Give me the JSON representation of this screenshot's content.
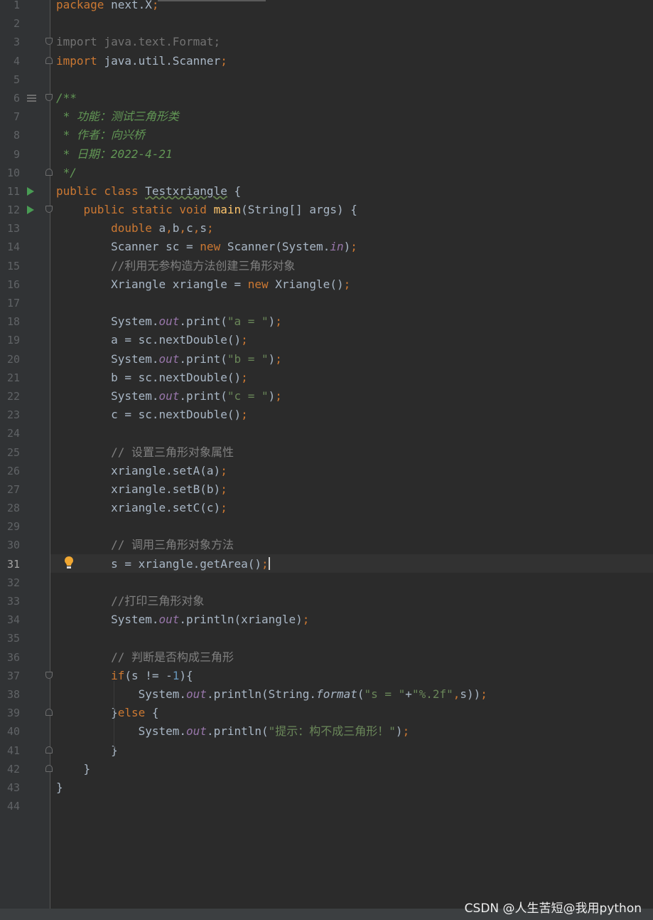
{
  "editor": {
    "file_language": "java",
    "current_line": 31,
    "lines": [
      {
        "n": "1",
        "tokens": [
          {
            "t": "package ",
            "c": "kw"
          },
          {
            "t": "next.X",
            "c": ""
          },
          {
            "t": ";",
            "c": "kw"
          }
        ]
      },
      {
        "n": "2",
        "tokens": []
      },
      {
        "n": "3",
        "fold": "open",
        "tokens": [
          {
            "t": "import java.text.Format;",
            "c": "dim"
          }
        ]
      },
      {
        "n": "4",
        "fold": "close",
        "tokens": [
          {
            "t": "import ",
            "c": "kw"
          },
          {
            "t": "java.util.Scanner",
            "c": ""
          },
          {
            "t": ";",
            "c": "kw"
          }
        ]
      },
      {
        "n": "5",
        "tokens": []
      },
      {
        "n": "6",
        "fold": "open",
        "marker": "menu",
        "tokens": [
          {
            "t": "/**",
            "c": "doc"
          }
        ]
      },
      {
        "n": "7",
        "tokens": [
          {
            "t": " * 功能：测试三角形类",
            "c": "doc"
          }
        ]
      },
      {
        "n": "8",
        "tokens": [
          {
            "t": " * 作者：向兴桥",
            "c": "doc"
          }
        ]
      },
      {
        "n": "9",
        "tokens": [
          {
            "t": " * 日期：2022-4-21",
            "c": "doc"
          }
        ]
      },
      {
        "n": "10",
        "fold": "close",
        "tokens": [
          {
            "t": " */",
            "c": "doc"
          }
        ]
      },
      {
        "n": "11",
        "marker": "run",
        "tokens": [
          {
            "t": "public class ",
            "c": "kw"
          },
          {
            "t": "Testxriangle",
            "c": "under"
          },
          {
            "t": " {",
            "c": ""
          }
        ]
      },
      {
        "n": "12",
        "marker": "run",
        "fold": "open",
        "tokens": [
          {
            "t": "    public static void ",
            "c": "kw"
          },
          {
            "t": "main",
            "c": "fn"
          },
          {
            "t": "(String[] args) {",
            "c": ""
          }
        ]
      },
      {
        "n": "13",
        "tokens": [
          {
            "t": "        double ",
            "c": "kw"
          },
          {
            "t": "a",
            "c": ""
          },
          {
            "t": ",",
            "c": "kw"
          },
          {
            "t": "b",
            "c": ""
          },
          {
            "t": ",",
            "c": "kw"
          },
          {
            "t": "c",
            "c": ""
          },
          {
            "t": ",",
            "c": "kw"
          },
          {
            "t": "s",
            "c": ""
          },
          {
            "t": ";",
            "c": "kw"
          }
        ]
      },
      {
        "n": "14",
        "tokens": [
          {
            "t": "        Scanner sc = ",
            "c": ""
          },
          {
            "t": "new ",
            "c": "kw"
          },
          {
            "t": "Scanner(System.",
            "c": ""
          },
          {
            "t": "in",
            "c": "sf"
          },
          {
            "t": ")",
            "c": ""
          },
          {
            "t": ";",
            "c": "kw"
          }
        ]
      },
      {
        "n": "15",
        "tokens": [
          {
            "t": "        //利用无参构造方法创建三角形对象",
            "c": "cmt"
          }
        ]
      },
      {
        "n": "16",
        "tokens": [
          {
            "t": "        Xriangle xriangle = ",
            "c": ""
          },
          {
            "t": "new ",
            "c": "kw"
          },
          {
            "t": "Xriangle()",
            "c": ""
          },
          {
            "t": ";",
            "c": "kw"
          }
        ]
      },
      {
        "n": "17",
        "tokens": []
      },
      {
        "n": "18",
        "tokens": [
          {
            "t": "        System.",
            "c": ""
          },
          {
            "t": "out",
            "c": "sf"
          },
          {
            "t": ".print(",
            "c": ""
          },
          {
            "t": "\"a = \"",
            "c": "str"
          },
          {
            "t": ")",
            "c": ""
          },
          {
            "t": ";",
            "c": "kw"
          }
        ]
      },
      {
        "n": "19",
        "tokens": [
          {
            "t": "        a = sc.nextDouble()",
            "c": ""
          },
          {
            "t": ";",
            "c": "kw"
          }
        ]
      },
      {
        "n": "20",
        "tokens": [
          {
            "t": "        System.",
            "c": ""
          },
          {
            "t": "out",
            "c": "sf"
          },
          {
            "t": ".print(",
            "c": ""
          },
          {
            "t": "\"b = \"",
            "c": "str"
          },
          {
            "t": ")",
            "c": ""
          },
          {
            "t": ";",
            "c": "kw"
          }
        ]
      },
      {
        "n": "21",
        "tokens": [
          {
            "t": "        b = sc.nextDouble()",
            "c": ""
          },
          {
            "t": ";",
            "c": "kw"
          }
        ]
      },
      {
        "n": "22",
        "tokens": [
          {
            "t": "        System.",
            "c": ""
          },
          {
            "t": "out",
            "c": "sf"
          },
          {
            "t": ".print(",
            "c": ""
          },
          {
            "t": "\"c = \"",
            "c": "str"
          },
          {
            "t": ")",
            "c": ""
          },
          {
            "t": ";",
            "c": "kw"
          }
        ]
      },
      {
        "n": "23",
        "tokens": [
          {
            "t": "        c = sc.nextDouble()",
            "c": ""
          },
          {
            "t": ";",
            "c": "kw"
          }
        ]
      },
      {
        "n": "24",
        "tokens": []
      },
      {
        "n": "25",
        "tokens": [
          {
            "t": "        // 设置三角形对象属性",
            "c": "cmt"
          }
        ]
      },
      {
        "n": "26",
        "tokens": [
          {
            "t": "        xriangle.setA(a)",
            "c": ""
          },
          {
            "t": ";",
            "c": "kw"
          }
        ]
      },
      {
        "n": "27",
        "tokens": [
          {
            "t": "        xriangle.setB(b)",
            "c": ""
          },
          {
            "t": ";",
            "c": "kw"
          }
        ]
      },
      {
        "n": "28",
        "tokens": [
          {
            "t": "        xriangle.setC(c)",
            "c": ""
          },
          {
            "t": ";",
            "c": "kw"
          }
        ]
      },
      {
        "n": "29",
        "tokens": []
      },
      {
        "n": "30",
        "tokens": [
          {
            "t": "        // 调用三角形对象方法",
            "c": "cmt"
          }
        ]
      },
      {
        "n": "31",
        "marker": "bulb",
        "caret": true,
        "tokens": [
          {
            "t": "        s = xriangle.getArea()",
            "c": ""
          },
          {
            "t": ";",
            "c": "kw"
          }
        ]
      },
      {
        "n": "32",
        "tokens": []
      },
      {
        "n": "33",
        "tokens": [
          {
            "t": "        //打印三角形对象",
            "c": "cmt"
          }
        ]
      },
      {
        "n": "34",
        "tokens": [
          {
            "t": "        System.",
            "c": ""
          },
          {
            "t": "out",
            "c": "sf"
          },
          {
            "t": ".println(xriangle)",
            "c": ""
          },
          {
            "t": ";",
            "c": "kw"
          }
        ]
      },
      {
        "n": "35",
        "tokens": []
      },
      {
        "n": "36",
        "tokens": [
          {
            "t": "        // 判断是否构成三角形",
            "c": "cmt"
          }
        ]
      },
      {
        "n": "37",
        "fold": "open",
        "tokens": [
          {
            "t": "        if",
            "c": "kw"
          },
          {
            "t": "(s != -",
            "c": ""
          },
          {
            "t": "1",
            "c": "num"
          },
          {
            "t": "){",
            "c": ""
          }
        ]
      },
      {
        "n": "38",
        "tokens": [
          {
            "t": "            System.",
            "c": ""
          },
          {
            "t": "out",
            "c": "sf"
          },
          {
            "t": ".println(String.",
            "c": ""
          },
          {
            "t": "format",
            "c": "it"
          },
          {
            "t": "(",
            "c": ""
          },
          {
            "t": "\"s = \"",
            "c": "str"
          },
          {
            "t": "+",
            "c": ""
          },
          {
            "t": "\"%.2f\"",
            "c": "str"
          },
          {
            "t": ",",
            "c": "kw"
          },
          {
            "t": "s))",
            "c": ""
          },
          {
            "t": ";",
            "c": "kw"
          }
        ]
      },
      {
        "n": "39",
        "fold": "close",
        "tokens": [
          {
            "t": "        }",
            "c": ""
          },
          {
            "t": "else ",
            "c": "kw"
          },
          {
            "t": "{",
            "c": ""
          }
        ]
      },
      {
        "n": "40",
        "tokens": [
          {
            "t": "            System.",
            "c": ""
          },
          {
            "t": "out",
            "c": "sf"
          },
          {
            "t": ".println(",
            "c": ""
          },
          {
            "t": "\"提示：构不成三角形！\"",
            "c": "str"
          },
          {
            "t": ")",
            "c": ""
          },
          {
            "t": ";",
            "c": "kw"
          }
        ]
      },
      {
        "n": "41",
        "fold": "close",
        "tokens": [
          {
            "t": "        }",
            "c": ""
          }
        ]
      },
      {
        "n": "42",
        "fold": "close",
        "tokens": [
          {
            "t": "    }",
            "c": ""
          }
        ]
      },
      {
        "n": "43",
        "tokens": [
          {
            "t": "}",
            "c": ""
          }
        ]
      },
      {
        "n": "44",
        "tokens": []
      }
    ]
  },
  "watermark": "CSDN @人生苦短@我用python"
}
